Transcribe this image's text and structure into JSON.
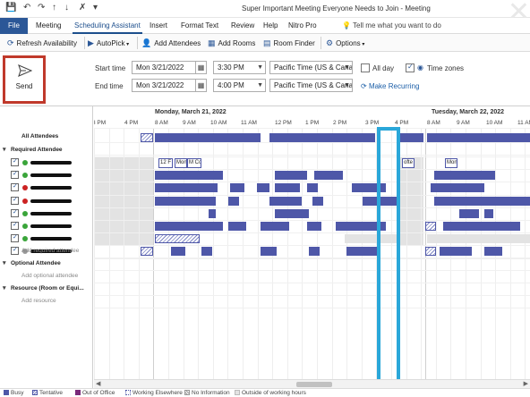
{
  "window": {
    "title": "Super Important Meeting Everyone Needs to Join  -  Meeting",
    "quick_access": [
      "save-icon",
      "undo-icon",
      "redo-icon",
      "up-icon",
      "down-icon",
      "clear-formatting-icon",
      "customize-icon"
    ]
  },
  "tabs": [
    {
      "label": "File"
    },
    {
      "label": "Meeting"
    },
    {
      "label": "Scheduling Assistant"
    },
    {
      "label": "Insert"
    },
    {
      "label": "Format Text"
    },
    {
      "label": "Review"
    },
    {
      "label": "Help"
    },
    {
      "label": "Nitro Pro"
    }
  ],
  "tell_me": "Tell me what you want to do",
  "ribbon": {
    "refresh": "Refresh Availability",
    "autopick": "AutoPick",
    "add_attendees": "Add Attendees",
    "add_rooms": "Add Rooms",
    "room_finder": "Room Finder",
    "options": "Options"
  },
  "form": {
    "send": "Send",
    "start_label": "Start time",
    "end_label": "End time",
    "start_date": "Mon 3/21/2022",
    "start_time": "3:30 PM",
    "end_date": "Mon 3/21/2022",
    "end_time": "4:00 PM",
    "start_tz": "Pacific Time (US & Cana",
    "end_tz": "Pacific Time (US & Cana",
    "all_day": "All day",
    "time_zones": "Time zones",
    "make_recurring": "Make Recurring"
  },
  "attendees": {
    "all_attendees": "All Attendees",
    "required_section": "Required Attendee",
    "add_required": "Add required attendee",
    "optional_section": "Optional Attendee",
    "add_optional": "Add optional attendee",
    "resource_section": "Resource (Room or Equi...",
    "add_resource": "Add resource",
    "status_colors": [
      "#3aa53a",
      "#3aa53a",
      "#cc2222",
      "#cc2222",
      "#3aa53a",
      "#3aa53a",
      "#3aa53a",
      "#999999"
    ]
  },
  "timeline": {
    "day1": "Monday, March 21, 2022",
    "day2": "Tuesday, March 22, 2022",
    "ticks": [
      "3 PM",
      "4 PM",
      "8 AM",
      "9 AM",
      "10 AM",
      "11 AM",
      "12 PM",
      "1 PM",
      "2 PM",
      "3 PM",
      "4 PM",
      "8 AM",
      "9 AM",
      "10 AM",
      "11 AM"
    ],
    "event_labels": [
      "12 F",
      "Mon",
      "M Co",
      "ofte",
      "Mon"
    ],
    "busy_color": "#4e57a8",
    "highlight_color": "#2aa7d9"
  },
  "legend": {
    "items": [
      "Busy",
      "Tentative",
      "Out of Office",
      "Working Elsewhere",
      "No Information",
      "Outside of working hours"
    ]
  }
}
